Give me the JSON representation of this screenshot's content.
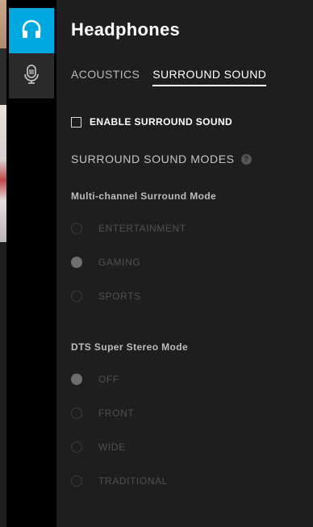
{
  "panel": {
    "title": "Headphones",
    "tabs": [
      {
        "label": "ACOUSTICS",
        "active": false
      },
      {
        "label": "SURROUND SOUND",
        "active": true
      }
    ],
    "enable_surround": {
      "label": "ENABLE SURROUND SOUND",
      "checked": false
    },
    "modes_heading": "SURROUND SOUND MODES",
    "help_symbol": "?",
    "multichannel": {
      "label": "Multi-channel Surround Mode",
      "options": [
        {
          "label": "ENTERTAINMENT",
          "selected": false
        },
        {
          "label": "GAMING",
          "selected": true
        },
        {
          "label": "SPORTS",
          "selected": false
        }
      ]
    },
    "dts": {
      "label": "DTS Super Stereo Mode",
      "options": [
        {
          "label": "OFF",
          "selected": true
        },
        {
          "label": "FRONT",
          "selected": false
        },
        {
          "label": "WIDE",
          "selected": false
        },
        {
          "label": "TRADITIONAL",
          "selected": false
        }
      ]
    }
  },
  "rail": {
    "items": [
      {
        "icon": "headphones-icon",
        "active": true
      },
      {
        "icon": "microphone-icon",
        "active": false
      }
    ]
  },
  "colors": {
    "accent": "#00a8e1",
    "panel_bg": "#1e1e1e",
    "rail_bg": "#000000"
  }
}
